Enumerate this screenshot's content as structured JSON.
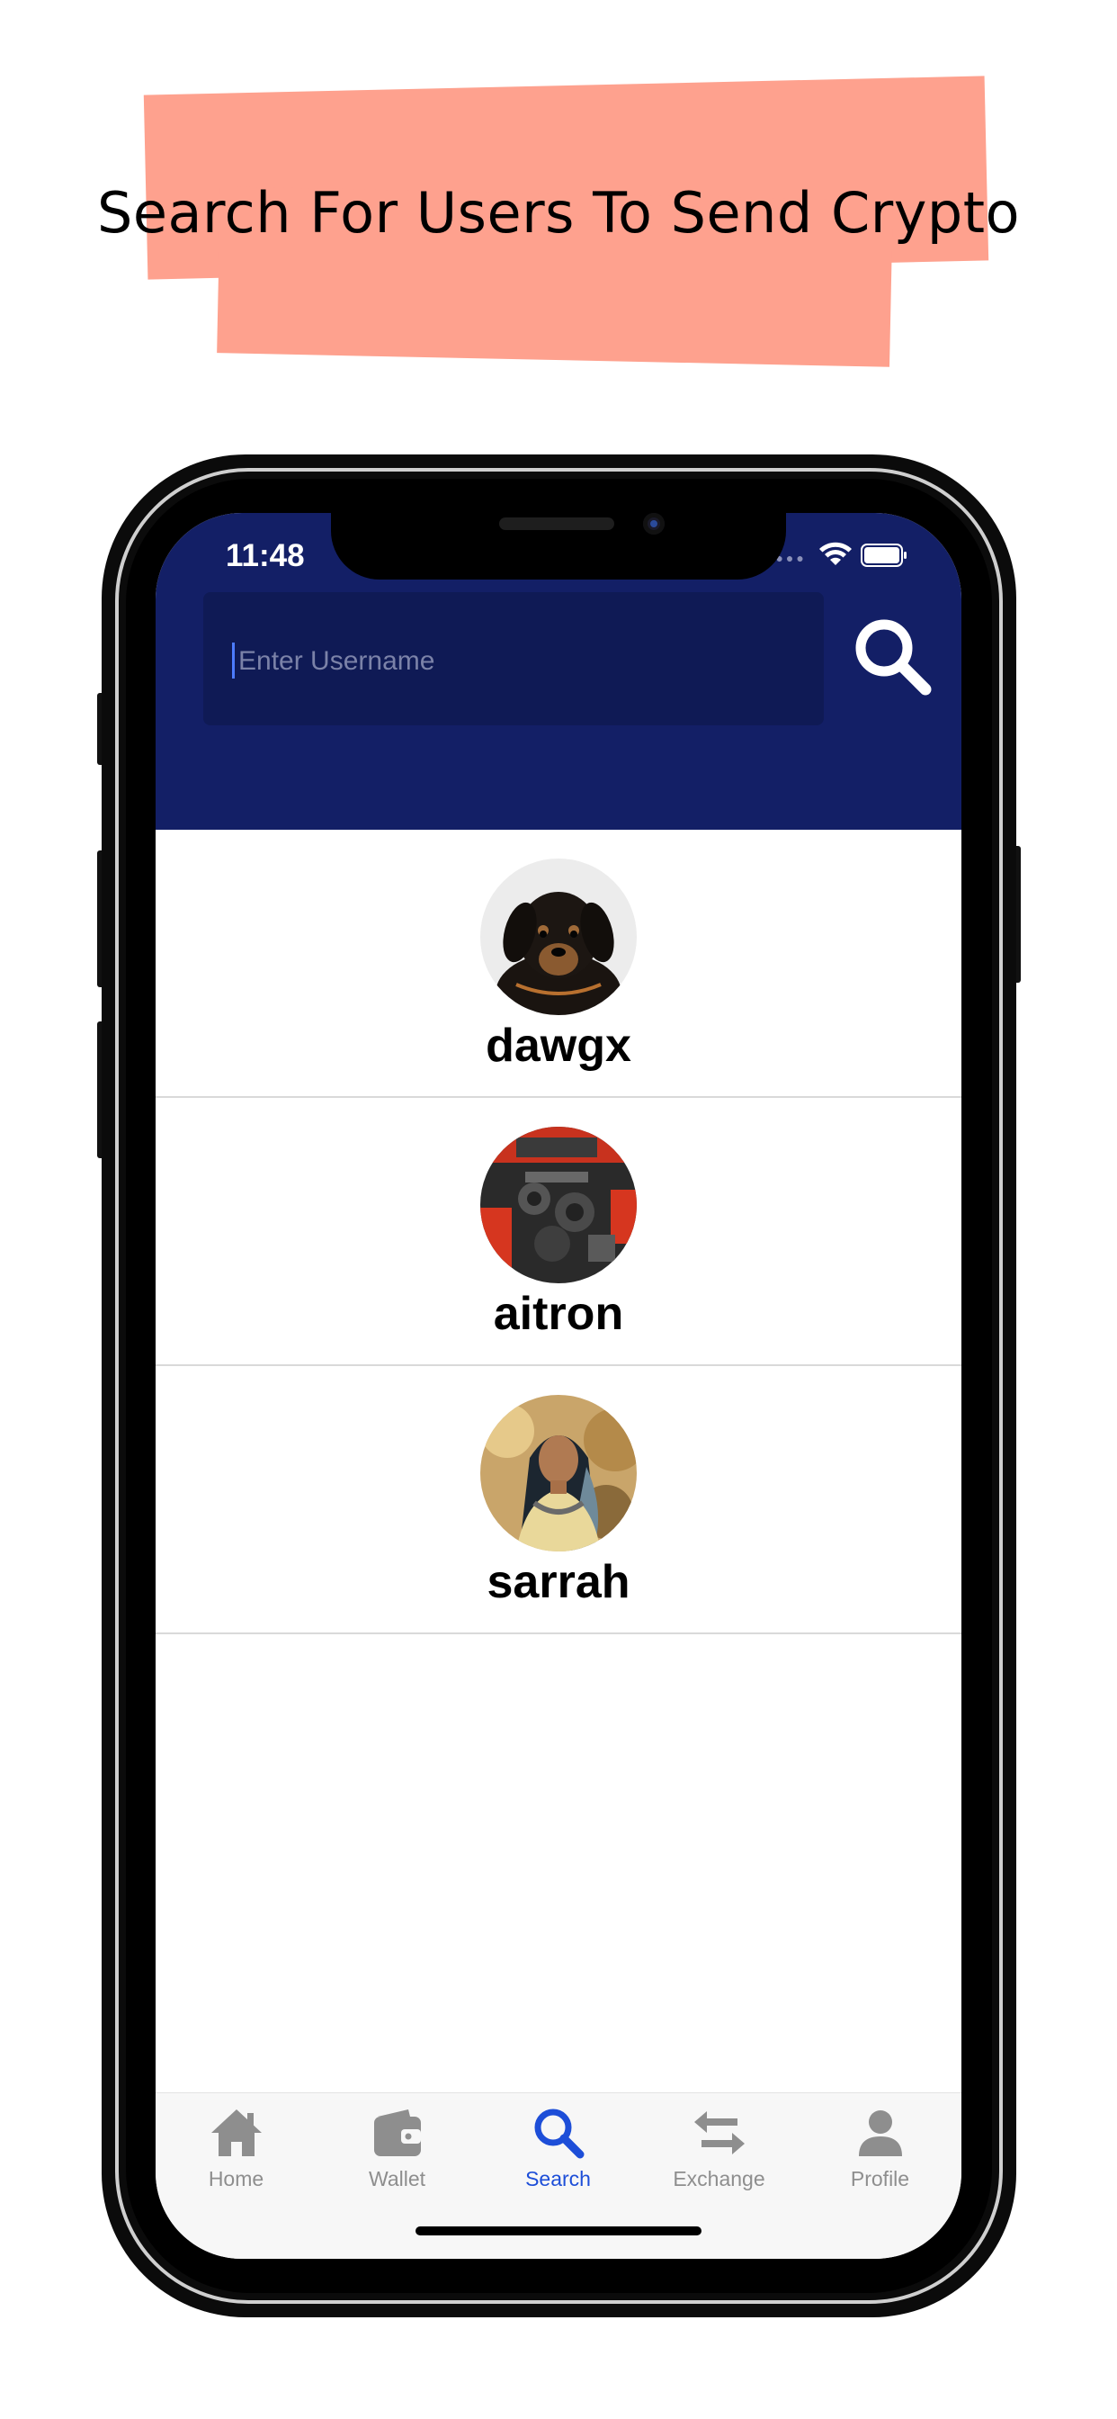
{
  "banner": {
    "headline": "Search For Users To Send Crypto"
  },
  "status_bar": {
    "time": "11:48"
  },
  "search": {
    "placeholder": "Enter Username",
    "value": ""
  },
  "users": [
    {
      "username": "dawgx",
      "avatar": "puppy-photo"
    },
    {
      "username": "aitron",
      "avatar": "engine-photo"
    },
    {
      "username": "sarrah",
      "avatar": "woman-portrait-photo"
    }
  ],
  "tabs": [
    {
      "label": "Home",
      "icon": "home-icon",
      "active": false
    },
    {
      "label": "Wallet",
      "icon": "wallet-icon",
      "active": false
    },
    {
      "label": "Search",
      "icon": "search-icon",
      "active": true
    },
    {
      "label": "Exchange",
      "icon": "exchange-icon",
      "active": false
    },
    {
      "label": "Profile",
      "icon": "profile-icon",
      "active": false
    }
  ],
  "colors": {
    "header_bg": "#131f66",
    "banner": "#fea18e",
    "active_tab": "#1d4ed8",
    "inactive_tab": "#8e8e8e"
  }
}
